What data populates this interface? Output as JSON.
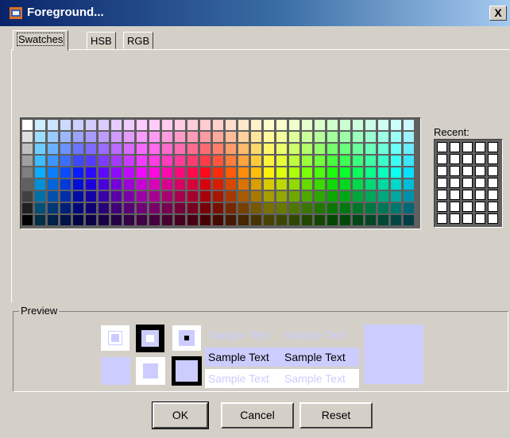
{
  "window": {
    "title": "Foreground...",
    "close_glyph": "X"
  },
  "tabs": [
    {
      "label": "Swatches",
      "active": true
    },
    {
      "label": "HSB",
      "active": false
    },
    {
      "label": "RGB",
      "active": false
    }
  ],
  "recent": {
    "label": "Recent:"
  },
  "preview": {
    "label": "Preview",
    "sample_text": "Sample Text",
    "selected_color": "#ccccff"
  },
  "buttons": {
    "ok": "OK",
    "cancel": "Cancel",
    "reset": "Reset"
  }
}
